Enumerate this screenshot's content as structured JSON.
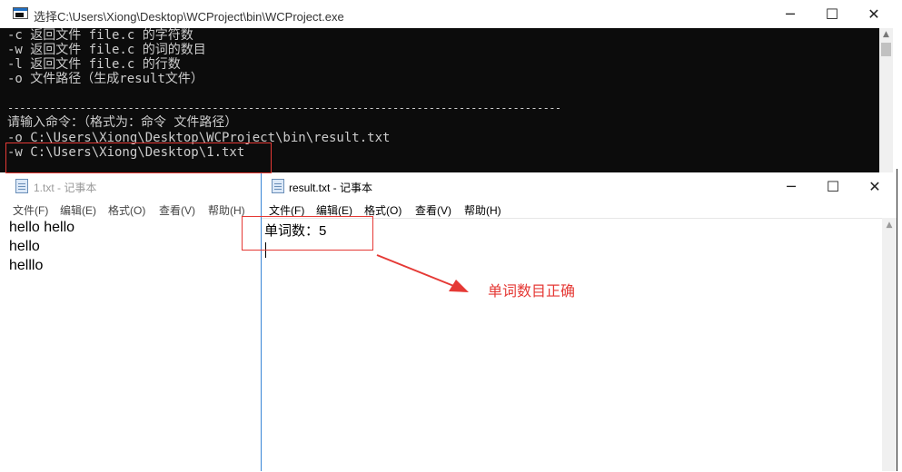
{
  "console": {
    "title": "选择C:\\Users\\Xiong\\Desktop\\WCProject\\bin\\WCProject.exe",
    "lines": [
      "-c 返回文件 file.c 的字符数",
      "-w 返回文件 file.c 的词的数目",
      "-l 返回文件 file.c 的行数",
      "-o 文件路径（生成result文件）",
      "",
      "--------------------------------------------------------------------------------------------",
      "请输入命令：（格式为：命令 文件路径）",
      "-o C:\\Users\\Xiong\\Desktop\\WCProject\\bin\\result.txt",
      "-w C:\\Users\\Xiong\\Desktop\\1.txt"
    ],
    "minimize_icon": "minimize-icon",
    "maximize_icon": "maximize-icon",
    "close_icon": "close-icon"
  },
  "notepad1": {
    "title": "1.txt - 记事本",
    "menu": [
      "文件(F)",
      "编辑(E)",
      "格式(O)",
      "查看(V)",
      "帮助(H)"
    ],
    "content": [
      "hello hello",
      "hello",
      "helllo"
    ]
  },
  "notepad2": {
    "title": "result.txt - 记事本",
    "menu": [
      "文件(F)",
      "编辑(E)",
      "格式(O)",
      "查看(V)",
      "帮助(H)"
    ],
    "content": "单词数：5",
    "minimize_icon": "minimize-icon",
    "maximize_icon": "maximize-icon",
    "close_icon": "close-icon"
  },
  "annotation": {
    "text": "单词数目正确",
    "color": "#e53935"
  }
}
